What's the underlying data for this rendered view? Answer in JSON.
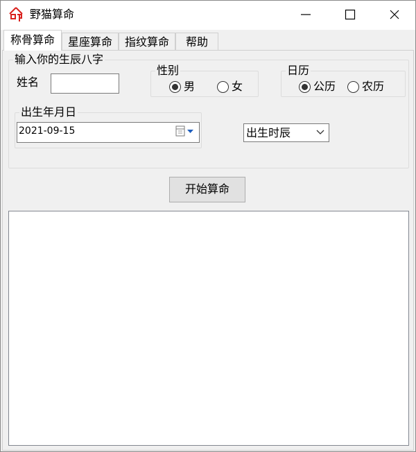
{
  "window": {
    "title": "野猫算命"
  },
  "tabs": [
    {
      "label": "称骨算命"
    },
    {
      "label": "星座算命"
    },
    {
      "label": "指纹算命"
    },
    {
      "label": "帮助"
    }
  ],
  "form": {
    "group_title": "输入你的生辰八字",
    "name_label": "姓名",
    "name_value": "",
    "gender": {
      "legend": "性别",
      "options": [
        "男",
        "女"
      ],
      "selected": "男"
    },
    "calendar": {
      "legend": "日历",
      "options": [
        "公历",
        "农历"
      ],
      "selected": "公历"
    },
    "birthdate": {
      "legend": "出生年月日",
      "value": "2021-09-15"
    },
    "birth_hour": {
      "value": "出生时辰"
    }
  },
  "action": {
    "start_label": "开始算命"
  },
  "output": {
    "text": ""
  },
  "icons": {
    "app": "fate-character-icon",
    "minimize": "minimize-icon",
    "maximize": "maximize-icon",
    "close": "close-icon",
    "calendar": "calendar-icon",
    "dropdown": "chevron-down-icon"
  },
  "colors": {
    "app_icon": "#d9201c",
    "accent": "#1e5ebe"
  }
}
